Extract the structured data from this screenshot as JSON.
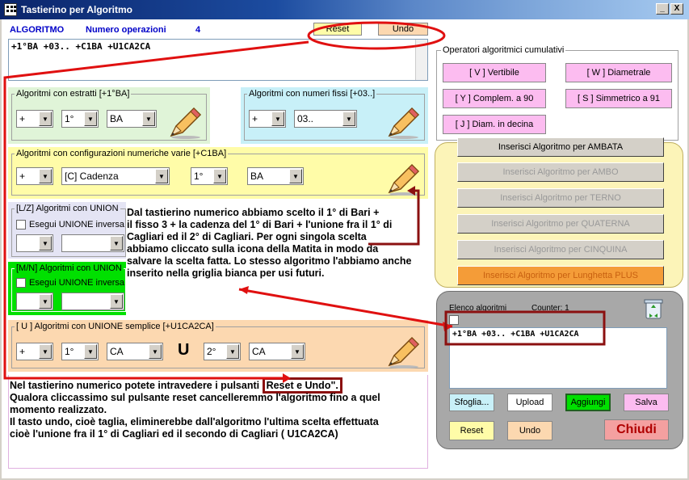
{
  "window": {
    "title": "Tastierino per Algoritmo",
    "minimize": "_",
    "close": "X"
  },
  "header": {
    "algo_label": "ALGORITMO",
    "ops_label": "Numero operazioni",
    "ops_count": "4",
    "reset": "Reset",
    "undo": "Undo"
  },
  "main_text": "+1°BA +03.. +C1BA +U1CA2CA",
  "groups": {
    "estratti": {
      "title": "Algoritmi con estratti  [+1°BA]",
      "sign": "+",
      "pos": "1°",
      "city": "BA"
    },
    "fissi": {
      "title": "Algoritmi con numeri fissi  [+03..]",
      "sign": "+",
      "value": "03.."
    },
    "config": {
      "title": "Algoritmi con configurazioni numeriche varie  [+C1BA]",
      "sign": "+",
      "type": "[C] Cadenza",
      "pos": "1°",
      "city": "BA"
    },
    "lz": {
      "title": "[L/Z] Algoritmi con UNION",
      "check": "Esegui UNIONE inversa"
    },
    "mn": {
      "title": "[M/N] Algoritmi con UNION",
      "check": "Esegui UNIONE inversa"
    },
    "unione": {
      "title": "[ U ] Algoritmi con UNIONE semplice  [+U1CA2CA]",
      "sign": "+",
      "pos1": "1°",
      "city1": "CA",
      "u": "U",
      "pos2": "2°",
      "city2": "CA"
    }
  },
  "operators": {
    "title": "Operatori algoritmici cumulativi",
    "buttons": [
      "[ V ] Vertibile",
      "[ W ] Diametrale",
      "[ Y ] Complem. a 90",
      "[ S ] Simmetrico  a 91",
      "[ J ] Diam. in decina"
    ]
  },
  "insert_buttons": [
    "Inserisci Algoritmo per AMBATA",
    "Inserisci Algoritmo per AMBO",
    "Inserisci Algoritmo per TERNO",
    "Inserisci Algoritmo per QUATERNA",
    "Inserisci Algoritmo per CINQUINA",
    "Inserisci Algoritmo per Lunghetta PLUS"
  ],
  "list": {
    "label": "Elenco algoritmi",
    "counter": "Counter: 1",
    "item": "+1°BA +03.. +C1BA +U1CA2CA"
  },
  "bottom_buttons": {
    "sfoglia": "Sfoglia...",
    "upload": "Upload",
    "aggiungi": "Aggiungi",
    "salva": "Salva",
    "reset": "Reset",
    "undo": "Undo",
    "chiudi": "Chiudi"
  },
  "note1": [
    "Dal tastierino numerico abbiamo scelto il 1° di Bari +",
    "il fisso 3 + la cadenza del 1° di Bari + l'unione fra il 1° di",
    "Cagliari  ed il 2° di Cagliari. Per ogni singola scelta",
    "abbiamo cliccato sulla icona della Matita in modo da",
    "salvare la scelta fatta. Lo stesso algoritmo l'abbiamo anche",
    "inserito nella griglia bianca per usi futuri."
  ],
  "note2": [
    "Nel tastierino numerico potete intravedere i pulsanti ",
    "Reset e Undo\".",
    "Qualora cliccassimo sul pulsante reset cancelleremmo l'algoritmo fino a quel",
    "momento realizzato.",
    "Il tasto undo, cioè taglia, eliminerebbe dall'algoritmo l'ultima scelta effettuata",
    "cioè l'unione fra il 1° di Cagliari ed il secondo di Cagliari ( U1CA2CA)"
  ],
  "colors": {
    "green_group": "#e0f4d8",
    "cyan_group": "#c8f0f8",
    "yellow_group": "#fffca8",
    "lavender_group": "#e4e4f4",
    "bright_green": "#00e000",
    "peach": "#fcd8b0",
    "pink": "#fcbcf0",
    "orange": "#f49c38",
    "annotation_red": "#e01010",
    "annotation_dark": "#8b1010"
  }
}
